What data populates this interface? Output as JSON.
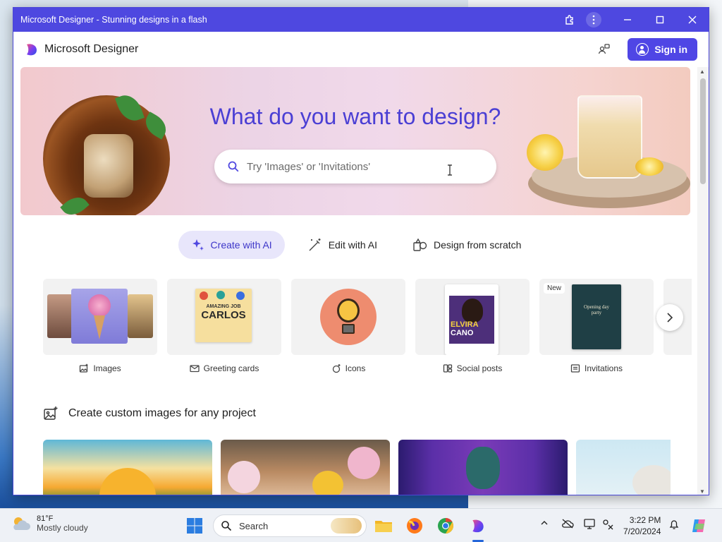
{
  "window": {
    "title": "Microsoft Designer - Stunning designs in a flash"
  },
  "appbar": {
    "brand": "Microsoft Designer",
    "signin_label": "Sign in"
  },
  "hero": {
    "heading": "What do you want to design?",
    "search_placeholder": "Try 'Images' or 'Invitations'"
  },
  "tabs": [
    {
      "label": "Create with AI",
      "icon": "sparkle-icon",
      "active": true
    },
    {
      "label": "Edit with AI",
      "icon": "magic-wand-icon",
      "active": false
    },
    {
      "label": "Design from scratch",
      "icon": "shapes-icon",
      "active": false
    }
  ],
  "categories": [
    {
      "label": "Images",
      "icon": "image-sparkle-icon"
    },
    {
      "label": "Greeting cards",
      "icon": "envelope-icon"
    },
    {
      "label": "Icons",
      "icon": "icon-sparkle-icon"
    },
    {
      "label": "Social posts",
      "icon": "social-post-icon"
    },
    {
      "label": "Invitations",
      "icon": "invitation-icon",
      "badge": "New"
    }
  ],
  "card_texts": {
    "greeting_line1": "AMAZING JOB",
    "greeting_line2": "CARLOS",
    "social_line1": "ELVIRA",
    "social_line2": "CANO",
    "invite_line1": "Opening day",
    "invite_line2": "party"
  },
  "section": {
    "title": "Create custom images for any project"
  },
  "taskbar": {
    "temperature": "81°F",
    "weather": "Mostly cloudy",
    "search_label": "Search",
    "time": "3:22 PM",
    "date": "7/20/2024"
  },
  "colors": {
    "accent": "#4f46e5",
    "titlebar": "#4e48e0",
    "hero_heading": "#4b3fd4"
  }
}
